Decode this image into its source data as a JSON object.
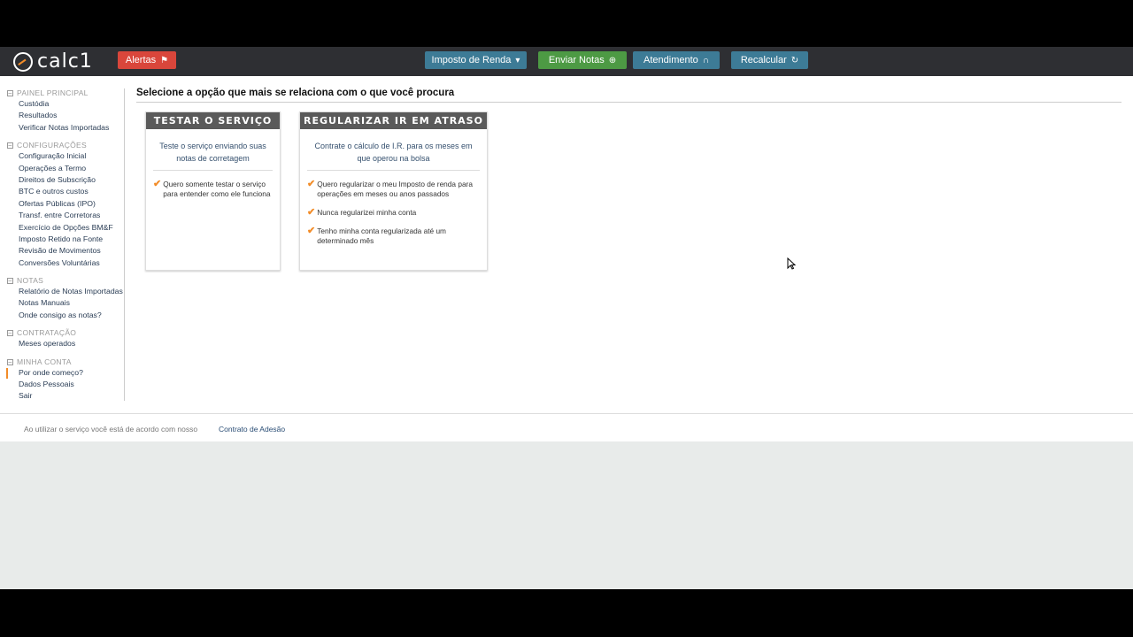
{
  "header": {
    "logo_text": "calc1",
    "alert_label": "Alertas",
    "buttons": {
      "imposto": "Imposto de Renda",
      "enviar": "Enviar Notas",
      "atendimento": "Atendimento",
      "recalcular": "Recalcular"
    }
  },
  "sidebar": {
    "sections": [
      {
        "title": "PAINEL PRINCIPAL",
        "items": [
          "Custódia",
          "Resultados",
          "Verificar Notas Importadas"
        ]
      },
      {
        "title": "CONFIGURAÇÕES",
        "items": [
          "Configuração Inicial",
          "Operações a Termo",
          "Direitos de Subscrição",
          "BTC e outros custos",
          "Ofertas Públicas (IPO)",
          "Transf. entre Corretoras",
          "Exercício de Opções BM&F",
          "Imposto Retido na Fonte",
          "Revisão de Movimentos",
          "Conversões Voluntárias"
        ]
      },
      {
        "title": "NOTAS",
        "items": [
          "Relatório de Notas Importadas",
          "Notas Manuais",
          "Onde consigo as notas?"
        ]
      },
      {
        "title": "CONTRATAÇÃO",
        "items": [
          "Meses operados"
        ]
      },
      {
        "title": "MINHA CONTA",
        "items": [
          "Por onde começo?",
          "Dados Pessoais",
          "Sair"
        ]
      }
    ]
  },
  "main": {
    "title": "Selecione a opção que mais se relaciona com o que você procura",
    "cards": [
      {
        "title": "TESTAR O SERVIÇO",
        "desc": "Teste o serviço enviando suas notas de corretagem",
        "checks": [
          "Quero somente testar o serviço para entender como ele funciona"
        ]
      },
      {
        "title": "REGULARIZAR IR EM ATRASO",
        "desc": "Contrate o cálculo de I.R. para os meses em que operou na bolsa",
        "checks": [
          "Quero regularizar o meu Imposto de renda para operações em meses ou anos passados",
          "Nunca regularizei minha conta",
          "Tenho minha conta regularizada até um determinado mês"
        ]
      }
    ]
  },
  "footer": {
    "text": "Ao utilizar o serviço você está de acordo com nosso",
    "link": "Contrato de Adesão"
  },
  "colors": {
    "topbar": "#2e2f33",
    "alert": "#d9463b",
    "blue_button": "#3d7b96",
    "green_button": "#4d9a44",
    "accent": "#f28c28"
  }
}
